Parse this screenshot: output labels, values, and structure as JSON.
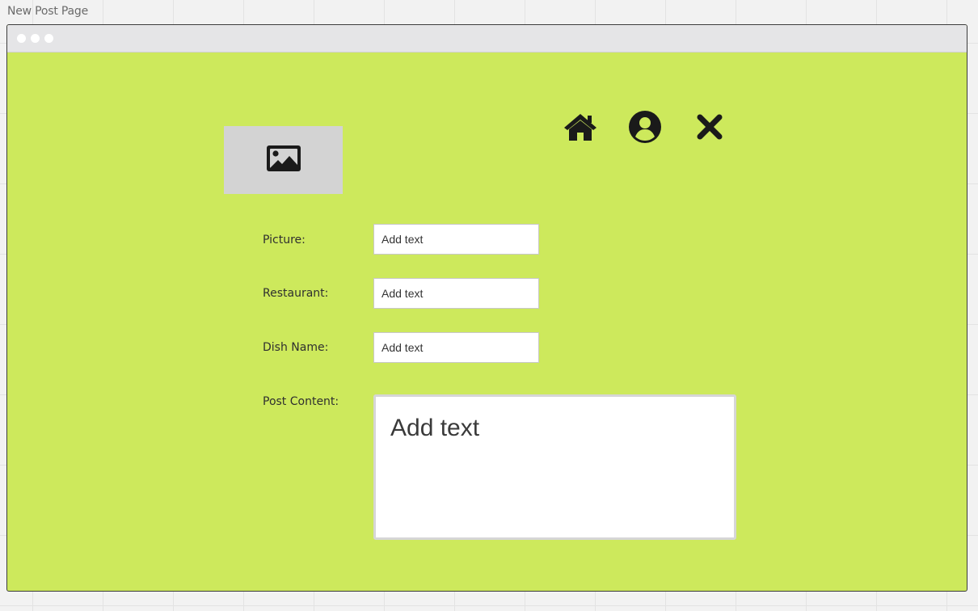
{
  "frame": {
    "title": "New Post Page"
  },
  "nav": {
    "home_icon": "home-icon",
    "profile_icon": "user-circle-icon",
    "close_icon": "close-icon"
  },
  "image_placeholder": {
    "icon": "image-icon"
  },
  "form": {
    "picture": {
      "label": "Picture:",
      "placeholder": "Add text"
    },
    "restaurant": {
      "label": "Restaurant:",
      "placeholder": "Add text"
    },
    "dish_name": {
      "label": "Dish Name:",
      "placeholder": "Add text"
    },
    "post_content": {
      "label": "Post Content:",
      "placeholder": "Add text"
    }
  },
  "colors": {
    "canvas": "#cde95c",
    "titlebar": "#e5e5e7",
    "icon": "#1a1a1a",
    "placeholder_bg": "#d3d3d3"
  }
}
